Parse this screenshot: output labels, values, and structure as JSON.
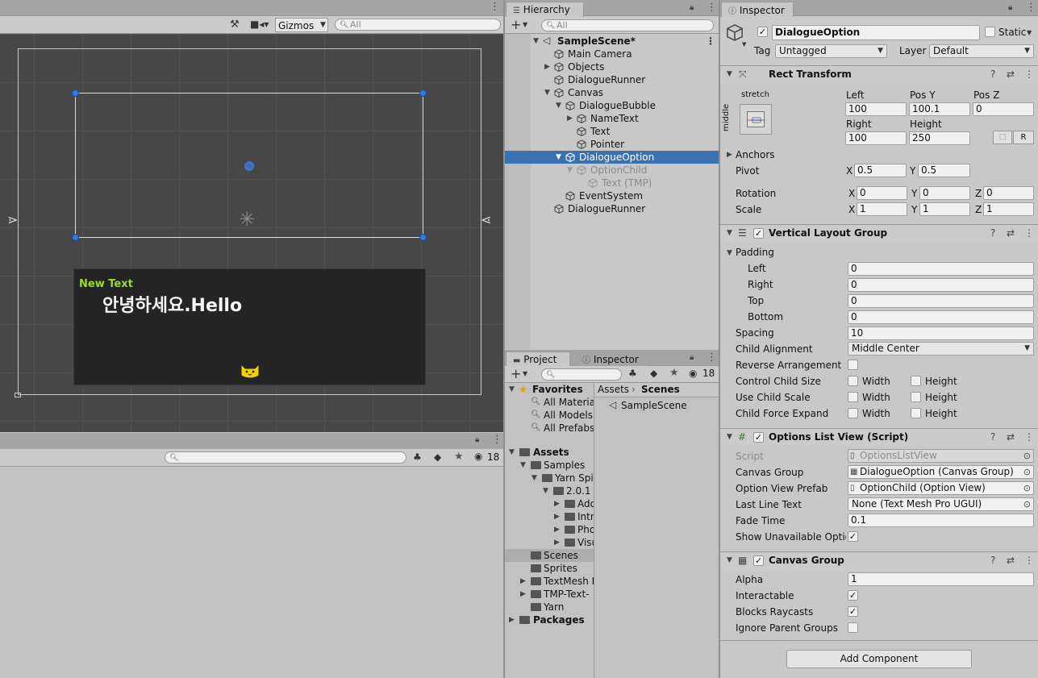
{
  "scene_view": {
    "gizmos_label": "Gizmos",
    "search_placeholder": "All",
    "new_text": "New Text",
    "dialogue_text": "안녕하세요.Hello"
  },
  "console": {
    "hidden_count": "18"
  },
  "hierarchy": {
    "tab_label": "Hierarchy",
    "search_placeholder": "All",
    "items": [
      {
        "label": "SampleScene*"
      },
      {
        "label": "Main Camera"
      },
      {
        "label": "Objects"
      },
      {
        "label": "DialogueRunner"
      },
      {
        "label": "Canvas"
      },
      {
        "label": "DialogueBubble"
      },
      {
        "label": "NameText"
      },
      {
        "label": "Text"
      },
      {
        "label": "Pointer"
      },
      {
        "label": "DialogueOption"
      },
      {
        "label": "OptionChild"
      },
      {
        "label": "Text (TMP)"
      },
      {
        "label": "EventSystem"
      },
      {
        "label": "DialogueRunner"
      }
    ]
  },
  "project": {
    "tab_label": "Project",
    "inspector_tab_label": "Inspector",
    "hidden_count": "18",
    "breadcrumb": [
      "Assets",
      "Scenes"
    ],
    "scene_file": "SampleScene",
    "tree": [
      {
        "label": "Favorites"
      },
      {
        "label": "All Materia"
      },
      {
        "label": "All Models"
      },
      {
        "label": "All Prefabs"
      },
      {
        "label": "Assets"
      },
      {
        "label": "Samples"
      },
      {
        "label": "Yarn Spi"
      },
      {
        "label": "2.0.1"
      },
      {
        "label": "Add"
      },
      {
        "label": "Intr"
      },
      {
        "label": "Pho"
      },
      {
        "label": "Visu"
      },
      {
        "label": "Scenes"
      },
      {
        "label": "Sprites"
      },
      {
        "label": "TextMesh I"
      },
      {
        "label": "TMP-Text-"
      },
      {
        "label": "Yarn"
      },
      {
        "label": "Packages"
      }
    ]
  },
  "inspector": {
    "tab_label": "Inspector",
    "object_name": "DialogueOption",
    "static_label": "Static",
    "tag_label": "Tag",
    "tag_value": "Untagged",
    "layer_label": "Layer",
    "layer_value": "Default",
    "rect_transform": {
      "title": "Rect Transform",
      "stretch_label": "stretch",
      "middle_label": "middle",
      "left_label": "Left",
      "left_value": "100",
      "posy_label": "Pos Y",
      "posy_value": "100.1",
      "posz_label": "Pos Z",
      "posz_value": "0",
      "right_label": "Right",
      "right_value": "100",
      "height_label": "Height",
      "height_value": "250",
      "r_button": "R",
      "anchors_label": "Anchors",
      "pivot_label": "Pivot",
      "pivot_x": "0.5",
      "pivot_y": "0.5",
      "rotation_label": "Rotation",
      "rot_x": "0",
      "rot_y": "0",
      "rot_z": "0",
      "scale_label": "Scale",
      "scale_x": "1",
      "scale_y": "1",
      "scale_z": "1",
      "x": "X",
      "y": "Y",
      "z": "Z"
    },
    "vlg": {
      "title": "Vertical Layout Group",
      "padding_label": "Padding",
      "left_label": "Left",
      "left_value": "0",
      "right_label": "Right",
      "right_value": "0",
      "top_label": "Top",
      "top_value": "0",
      "bottom_label": "Bottom",
      "bottom_value": "0",
      "spacing_label": "Spacing",
      "spacing_value": "10",
      "child_alignment_label": "Child Alignment",
      "child_alignment_value": "Middle Center",
      "reverse_label": "Reverse Arrangement",
      "control_label": "Control Child Size",
      "use_scale_label": "Use Child Scale",
      "force_expand_label": "Child Force Expand",
      "width": "Width",
      "height": "Height"
    },
    "options_list": {
      "title": "Options List View (Script)",
      "script_label": "Script",
      "script_value": "OptionsListView",
      "canvas_group_label": "Canvas Group",
      "canvas_group_value": "DialogueOption (Canvas Group)",
      "prefab_label": "Option View Prefab",
      "prefab_value": "OptionChild (Option View)",
      "last_line_label": "Last Line Text",
      "last_line_value": "None (Text Mesh Pro UGUI)",
      "fade_label": "Fade Time",
      "fade_value": "0.1",
      "show_unavailable_label": "Show Unavailable Option"
    },
    "canvas_group": {
      "title": "Canvas Group",
      "alpha_label": "Alpha",
      "alpha_value": "1",
      "interactable_label": "Interactable",
      "blocks_label": "Blocks Raycasts",
      "ignore_label": "Ignore Parent Groups"
    },
    "add_component_label": "Add Component"
  }
}
